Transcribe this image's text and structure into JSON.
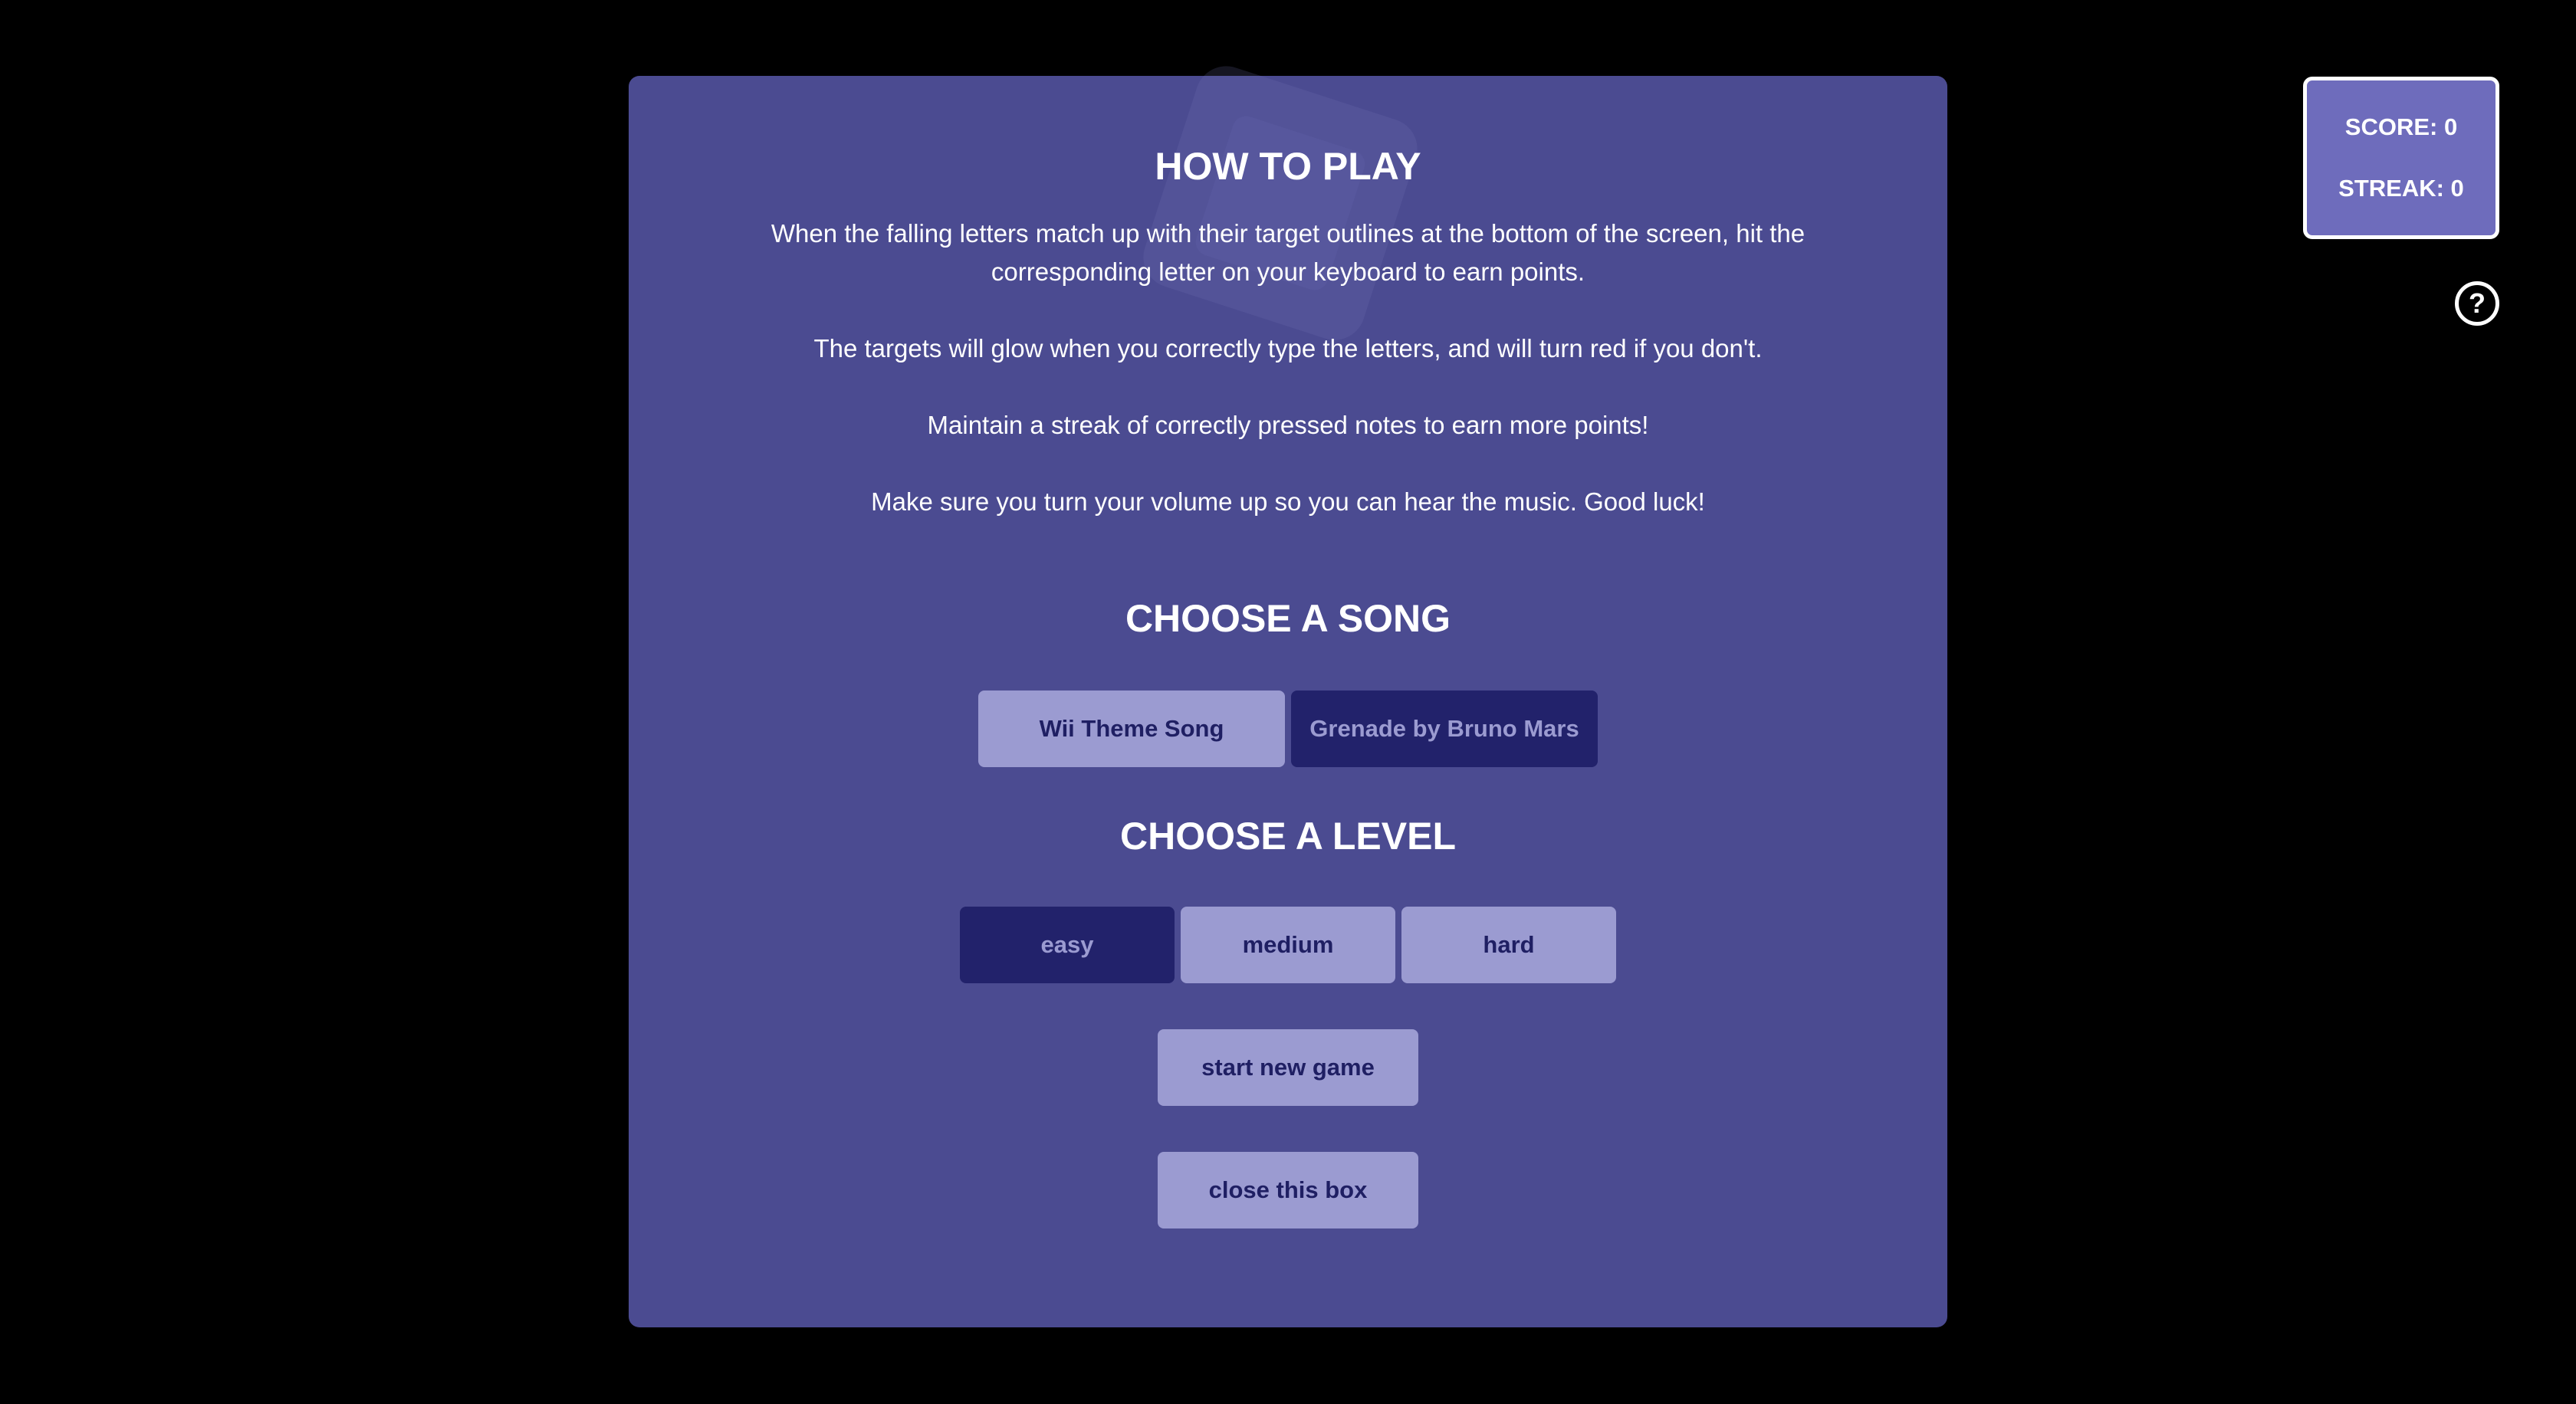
{
  "scoreboard": {
    "score_label": "SCORE: 0",
    "streak_label": "STREAK: 0"
  },
  "help": {
    "icon": "question-circle-icon",
    "glyph": "?"
  },
  "modal": {
    "how_to_play": {
      "title": "HOW TO PLAY",
      "paragraphs": [
        "When the falling letters match up with their target outlines at the bottom of the screen, hit the corresponding letter on your keyboard to earn points.",
        "The targets will glow when you correctly type the letters, and will turn red if you don't.",
        "Maintain a streak of correctly pressed notes to earn more points!",
        "Make sure you turn your volume up so you can hear the music. Good luck!"
      ]
    },
    "song": {
      "title": "CHOOSE A SONG",
      "options": [
        "Wii Theme Song",
        "Grenade by Bruno Mars"
      ],
      "selected": "Grenade by Bruno Mars"
    },
    "level": {
      "title": "CHOOSE A LEVEL",
      "options": [
        "easy",
        "medium",
        "hard"
      ],
      "selected": "easy"
    },
    "start_label": "start new game",
    "close_label": "close this box"
  },
  "colors": {
    "background": "#000000",
    "modal": "#4b4b91",
    "button_light": "#9b9bd1",
    "button_dark": "#22226b",
    "score_panel": "#6e6cbc"
  }
}
